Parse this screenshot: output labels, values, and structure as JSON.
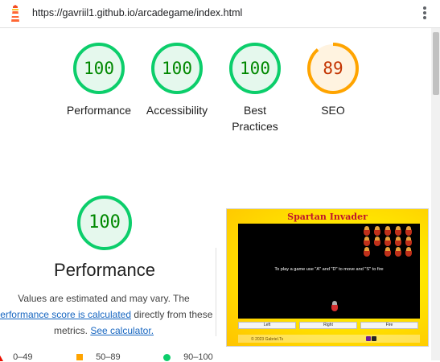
{
  "address_bar": {
    "url": "https://gavriil1.github.io/arcadegame/index.html"
  },
  "colors": {
    "pass": "#0cce6b",
    "pass_text": "#008800",
    "average": "#ffa400",
    "average_text": "#c33300",
    "fail": "#eb0f00",
    "link": "#1565c0"
  },
  "icons": {
    "lighthouse": "lighthouse-icon",
    "menu": "kebab-menu-icon"
  },
  "scores": [
    {
      "label": "Performance",
      "value": "100",
      "fraction": 1.0,
      "rating": "pass"
    },
    {
      "label": "Accessibility",
      "value": "100",
      "fraction": 1.0,
      "rating": "pass"
    },
    {
      "label": "Best Practices",
      "value": "100",
      "fraction": 1.0,
      "rating": "pass"
    },
    {
      "label": "SEO",
      "value": "89",
      "fraction": 0.89,
      "rating": "average"
    }
  ],
  "performance": {
    "value": "100",
    "fraction": 1.0,
    "title": "Performance",
    "desc_text1": "Values are estimated and may vary. The",
    "desc_link1": "performance score is calculated",
    "desc_text2": "directly from these metrics.",
    "desc_link2": "See calculator."
  },
  "legend": [
    {
      "range": "0–49",
      "shape": "triangle",
      "color": "#eb0f00"
    },
    {
      "range": "50–89",
      "shape": "square",
      "color": "#ffa400"
    },
    {
      "range": "90–100",
      "shape": "circle",
      "color": "#0cce6b"
    }
  ],
  "screenshot": {
    "game_title": "Spartan Invader",
    "instructions": "To play a game use \"A\" and \"D\" to move and \"S\" to fire",
    "buttons": {
      "left": "Left",
      "right": "Right",
      "fire": "Fire"
    },
    "copyright": "© 2023 Gabriel.Ts"
  }
}
